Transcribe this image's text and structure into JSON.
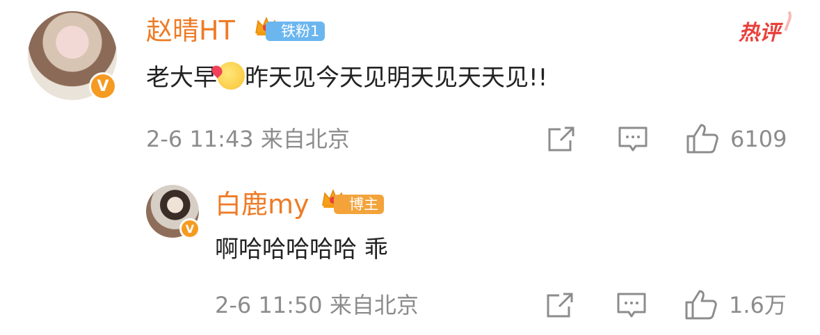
{
  "comment": {
    "username": "赵晴HT",
    "fan_badge": "铁粉1",
    "hot_tag": "热评",
    "text_before_emoji": "老大早",
    "text_after_emoji": "昨天见今天见明天见天天见!!",
    "timestamp": "2-6 11:43",
    "location": "来自北京",
    "like_count": "6109",
    "emoji_icon": "kiss-emoji-icon",
    "verified_badge": "v-icon"
  },
  "reply": {
    "username": "白鹿my",
    "role_badge": "博主",
    "text": "啊哈哈哈哈哈 乖",
    "timestamp": "2-6 11:50",
    "location": "来自北京",
    "like_count": "1.6万",
    "verified_badge": "v-icon"
  },
  "colors": {
    "username": "#ee7b26",
    "fan_badge": "#6bb6ef",
    "blog_badge": "#f3a33a",
    "hot_tag": "#e8413b",
    "meta_text": "#8c8c8c"
  }
}
